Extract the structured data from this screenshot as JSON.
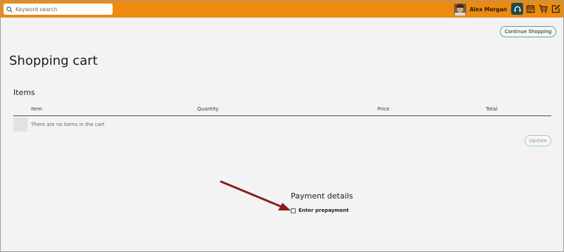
{
  "header": {
    "search_placeholder": "Keyword search",
    "user_name": "Alex Morgan",
    "accent_color": "#ee8a0e",
    "icons": [
      "search-icon",
      "avatar",
      "chevron-down-icon",
      "support-headset-icon",
      "calendar-icon",
      "shopping-cart-icon",
      "edit-note-icon"
    ]
  },
  "main": {
    "continue_label": "Continue Shopping",
    "page_title": "Shopping cart",
    "items": {
      "title": "Items",
      "columns": [
        "Item",
        "Quantity",
        "Price",
        "Total"
      ],
      "empty_text": "There are no items in the cart",
      "update_label": "Update"
    },
    "payment": {
      "title": "Payment details",
      "prepayment_label": "Enter prepayment",
      "prepayment_checked": false
    }
  },
  "annotation": {
    "color": "#8b1c1c",
    "icon": "pointer-arrow"
  }
}
